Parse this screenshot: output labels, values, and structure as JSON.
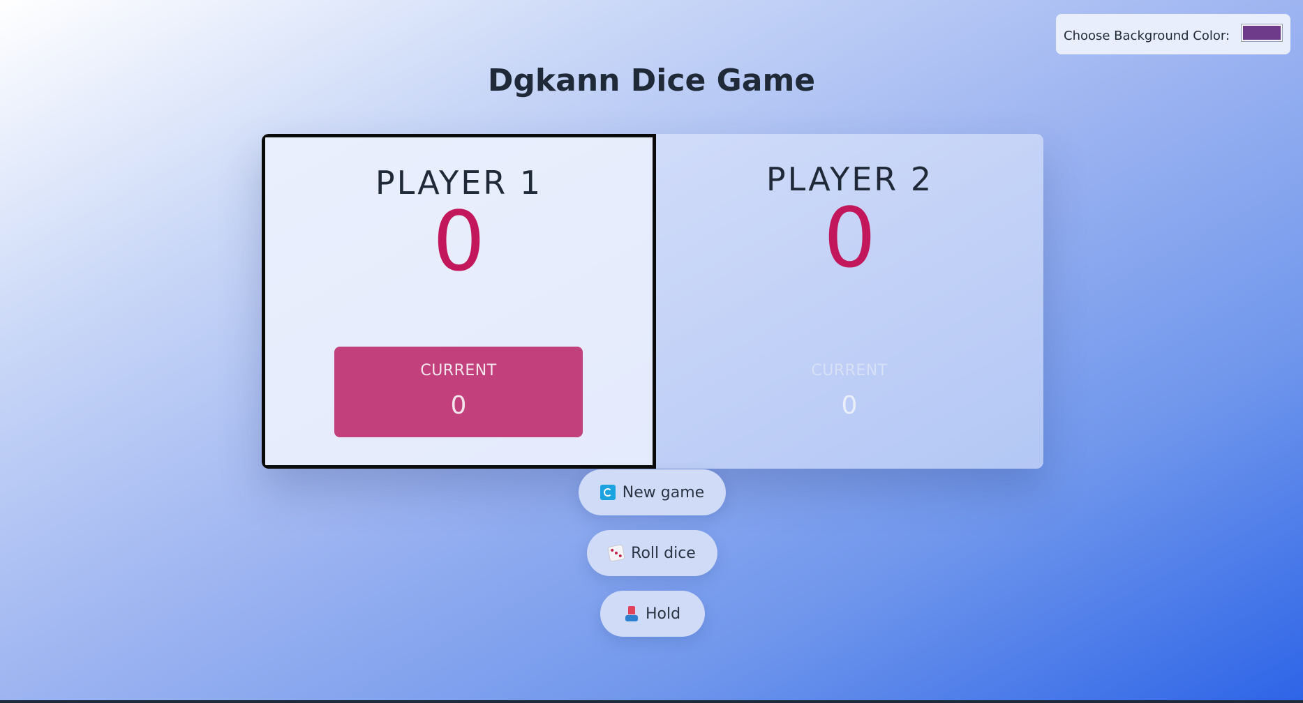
{
  "color_chooser": {
    "label": "Choose Background Color:",
    "value": "#6e3a8a"
  },
  "title": "Dgkann Dice Game",
  "players": [
    {
      "name": "PLAYER 1",
      "score": "0",
      "current_label": "CURRENT",
      "current_score": "0",
      "active": true
    },
    {
      "name": "PLAYER 2",
      "score": "0",
      "current_label": "CURRENT",
      "current_score": "0",
      "active": false
    }
  ],
  "buttons": {
    "new_game": {
      "label": "New game",
      "icon": "refresh-icon"
    },
    "roll_dice": {
      "label": "Roll dice",
      "icon": "dice-icon"
    },
    "hold": {
      "label": "Hold",
      "icon": "inbox-tray-icon"
    }
  },
  "colors": {
    "score": "#c2185b",
    "active_current_bg": "#c2407b",
    "swatch": "#6e3a8a"
  }
}
